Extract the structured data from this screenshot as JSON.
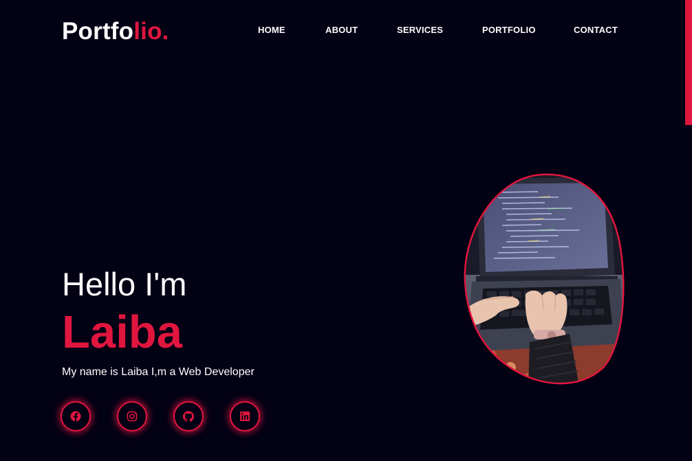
{
  "header": {
    "logo_main": "Portfo",
    "logo_accent": "lio."
  },
  "nav": {
    "items": [
      {
        "label": "HOME"
      },
      {
        "label": "ABOUT"
      },
      {
        "label": "SERVICES"
      },
      {
        "label": "PORTFOLIO"
      },
      {
        "label": "CONTACT"
      }
    ]
  },
  "hero": {
    "greeting": "Hello I'm",
    "name": "Laiba",
    "tagline": "My name is Laiba I,m a Web Developer",
    "image_alt": "hands typing code on a laptop"
  },
  "socials": [
    {
      "icon": "facebook-icon"
    },
    {
      "icon": "instagram-icon"
    },
    {
      "icon": "github-icon"
    },
    {
      "icon": "linkedin-icon"
    }
  ],
  "colors": {
    "background": "#030114",
    "accent": "#e0163f",
    "text": "#ffffff"
  }
}
